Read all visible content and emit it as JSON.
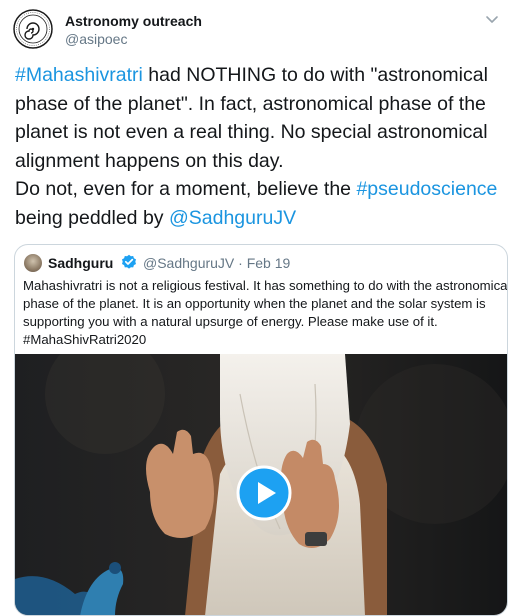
{
  "tweet": {
    "author_name": "Astronomy outreach",
    "author_handle": "@asipoec",
    "text_lines": [
      [
        {
          "t": "#Mahashivratri",
          "link": true
        },
        {
          "t": " had NOTHING to do with \"astronomical"
        }
      ],
      [
        {
          "t": "phase of the planet\". In fact, astronomical phase of the"
        }
      ],
      [
        {
          "t": "planet is not even a real thing. No special astronomical"
        }
      ],
      [
        {
          "t": "alignment happens on this day."
        }
      ],
      [
        {
          "t": "Do not, even for a moment, believe the "
        },
        {
          "t": "#pseudoscience",
          "link": true
        }
      ],
      [
        {
          "t": " being peddled by "
        },
        {
          "t": "@SadhguruJV",
          "link": true
        }
      ]
    ]
  },
  "quoted_tweet": {
    "author_name": "Sadhguru",
    "author_handle": "@SadhguruJV · Feb 19",
    "verified": true,
    "text_lines": [
      "Mahashivratri is not a religious festival. It has something to do with the astronomical",
      "phase of the planet. It is an opportunity when the planet and the solar system is",
      "supporting you with a natural upsurge of energy. Please make use of it.",
      "#MahaShivRatri2020"
    ],
    "media": {
      "type": "video"
    }
  },
  "icons": {
    "avatar": "astronomy-society-logo-icon",
    "caret": "chevron-down-icon",
    "verified": "verified-badge-icon",
    "play": "play-icon"
  },
  "colors": {
    "link": "#1b95e0",
    "text": "#14171a",
    "secondary": "#657786",
    "border": "#ccd6dd",
    "play_button": "#1da1f2"
  }
}
